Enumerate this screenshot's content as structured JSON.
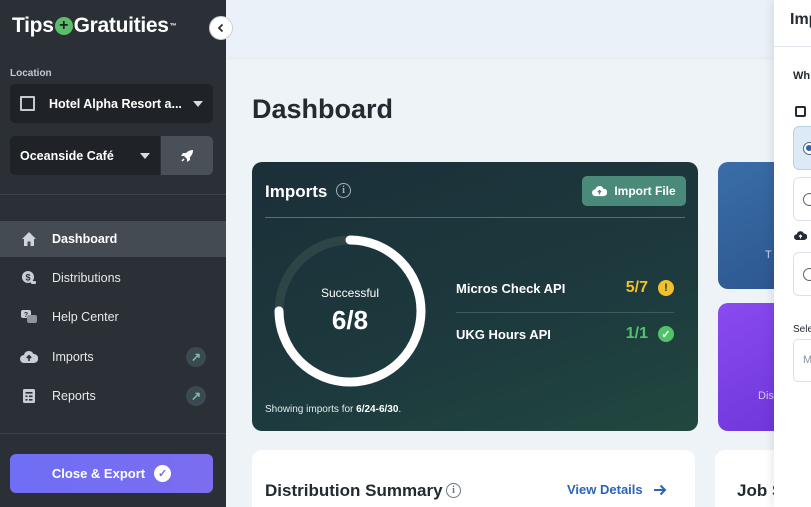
{
  "app": {
    "logo_left": "Tips",
    "logo_plus": "+",
    "logo_right": "Gratuities",
    "logo_tm": "™"
  },
  "sidebar": {
    "location_label": "Location",
    "hotel_value": "Hotel Alpha Resort a...",
    "venue_value": "Oceanside Café",
    "items": [
      {
        "label": "Dashboard",
        "icon": "home-icon",
        "active": true
      },
      {
        "label": "Distributions",
        "icon": "distributions-icon"
      },
      {
        "label": "Help Center",
        "icon": "help-center-icon"
      },
      {
        "label": "Imports",
        "icon": "cloud-upload-icon",
        "external": true
      },
      {
        "label": "Reports",
        "icon": "reports-icon",
        "external": true
      }
    ],
    "close_export_label": "Close & Export"
  },
  "main": {
    "page_title": "Dashboard",
    "imports": {
      "title": "Imports",
      "import_button": "Import File",
      "ring_label": "Successful",
      "ring_value": "6/8",
      "ring_fraction": 0.75,
      "apis": [
        {
          "name": "Micros Check API",
          "count": "5/7",
          "status": "warning",
          "color": "#f2c029"
        },
        {
          "name": "UKG Hours API",
          "count": "1/1",
          "status": "success",
          "color": "#52c26a"
        }
      ],
      "showing_prefix": "Showing imports for ",
      "showing_range": "6/24-6/30",
      "showing_suffix": "."
    },
    "side_cards": {
      "blue_text": "T",
      "purple_text": "Dis"
    },
    "distribution_summary": {
      "title": "Distribution Summary",
      "view_details": "View Details"
    },
    "job_card_title": "Job S"
  },
  "drawer": {
    "title": "Imp",
    "question": "Wh",
    "select_label": "Sele",
    "input_placeholder": "M"
  }
}
